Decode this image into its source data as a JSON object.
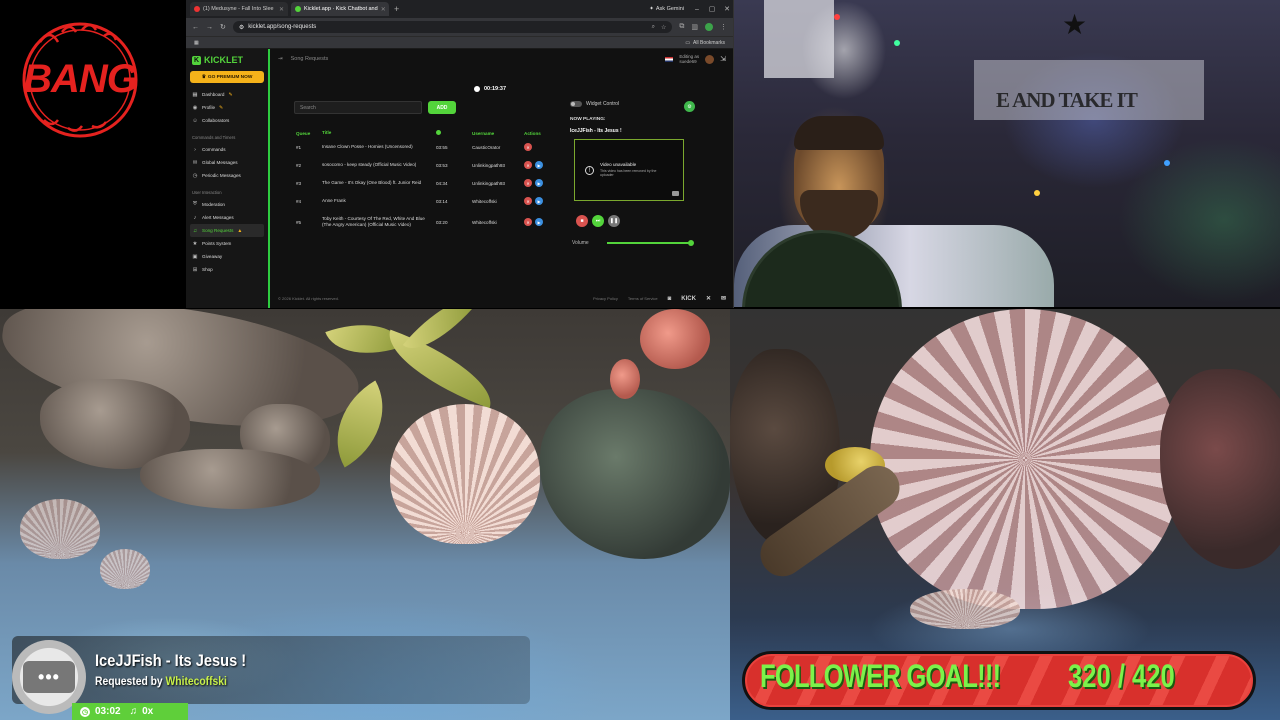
{
  "logo": {
    "word": "BANG",
    "arc_text": "ハルシー"
  },
  "browser": {
    "tabs": [
      {
        "label": "(1) Medusyne - Fall Into Slee",
        "favicon_color": "#e33"
      },
      {
        "label": "Kicklet.app · Kick Chatbot and",
        "favicon_color": "#53d43b"
      }
    ],
    "new_tab": "+",
    "ask_gemini": "Ask Gemini",
    "url": "kicklet.app/song-requests",
    "all_bookmarks": "All Bookmarks"
  },
  "kicklet": {
    "brand": "KICKLET",
    "premium_label": "GO PREMIUM NOW",
    "page_title": "Song Requests",
    "editing_as_label": "Editing as",
    "editing_as_user": "suede69",
    "nav_top": [
      {
        "label": "Dashboard",
        "icon": "grid-icon"
      },
      {
        "label": "Profile",
        "icon": "user-icon"
      },
      {
        "label": "Collaborators",
        "icon": "users-icon"
      }
    ],
    "section_commands": "Commands and Timers",
    "nav_commands": [
      {
        "label": "Commands",
        "icon": "terminal-icon"
      },
      {
        "label": "Global Messages",
        "icon": "chat-icon"
      },
      {
        "label": "Periodic Messages",
        "icon": "clock-icon"
      }
    ],
    "section_user": "User Interaction",
    "nav_user": [
      {
        "label": "Moderation",
        "icon": "shield-icon"
      },
      {
        "label": "Alert Messages",
        "icon": "bell-icon"
      },
      {
        "label": "Song Requests",
        "icon": "music-icon",
        "active": true
      },
      {
        "label": "Points System",
        "icon": "star-icon"
      },
      {
        "label": "Giveaway",
        "icon": "gift-icon"
      },
      {
        "label": "Shop",
        "icon": "cart-icon"
      }
    ],
    "timer": "00:19:37",
    "search_placeholder": "Search",
    "add_label": "ADD",
    "queue_headers": {
      "queue": "Queue",
      "title": "Title",
      "username": "Username",
      "actions": "Actions"
    },
    "queue": [
      {
        "pos": "#1",
        "title": "Insane Clown Posse - Homies (Uncensored)",
        "duration": "03:55",
        "user": "CausticOrator"
      },
      {
        "pos": "#2",
        "title": "sosocomo - keep steady (Official Music Video)",
        "duration": "03:53",
        "user": "Unlinkingpath93"
      },
      {
        "pos": "#3",
        "title": "The Game - It's Okay (One Blood) ft. Junior Reid",
        "duration": "04:34",
        "user": "Unlinkingpath93"
      },
      {
        "pos": "#4",
        "title": "Anne Frank",
        "duration": "03:14",
        "user": "Whitecoffski"
      },
      {
        "pos": "#5",
        "title": "Toby Keith - Courtesy Of The Red, White And Blue (The Angry American) (Official Music Video)",
        "duration": "03:20",
        "user": "Whitecoffski"
      }
    ],
    "widget_control": "Widget Control",
    "now_playing_label": "NOW PLAYING:",
    "now_playing_title": "IceJJFish - Its Jesus !",
    "video_unavailable": "Video unavailable",
    "video_unavailable_sub": "This video has been removed by the uploader",
    "volume_label": "Volume",
    "volume_level": 1.0,
    "footer_copyright": "© 2026 Kicklet. All rights reserved.",
    "footer_privacy": "Privacy Policy",
    "footer_terms": "Terms of Service",
    "footer_kick": "KICK"
  },
  "webcam": {
    "flag_text": "E AND TAKE IT"
  },
  "overlay": {
    "song": "IceJJFish - Its Jesus !",
    "requested_by": "Requested by",
    "requester": "Whitecoffski",
    "time": "03:02",
    "queue_count": "0x"
  },
  "goal": {
    "label": "FOLLOWER GOAL!!!",
    "count": "320 / 420",
    "current": 320,
    "target": 420,
    "color": "#d8302c",
    "text_color": "#7cf24a"
  }
}
